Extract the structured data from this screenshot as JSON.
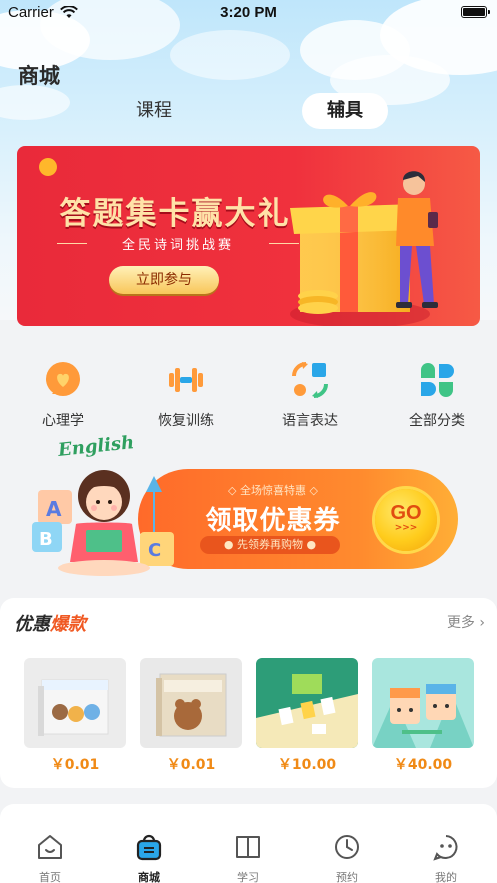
{
  "status_bar": {
    "carrier": "Carrier",
    "time": "3:20 PM"
  },
  "header": {
    "title": "商城"
  },
  "tabs": [
    {
      "label": "课程",
      "active": false
    },
    {
      "label": "辅具",
      "active": true
    }
  ],
  "banner": {
    "headline": "答题集卡赢大礼",
    "subtitle": "全民诗词挑战赛",
    "button": "立即参与"
  },
  "categories": [
    {
      "label": "心理学",
      "icon": "heart-bubble-icon"
    },
    {
      "label": "恢复训练",
      "icon": "dumbbell-icon"
    },
    {
      "label": "语言表达",
      "icon": "shapes-icon"
    },
    {
      "label": "全部分类",
      "icon": "four-petal-icon"
    }
  ],
  "coupon": {
    "decor_text": "English",
    "tag": "全场惊喜特惠",
    "headline": "领取优惠券",
    "pill": "先领券再购物",
    "go": "GO",
    "go_arrows": ">>>"
  },
  "hot": {
    "title_plain": "优惠",
    "title_emph": "爆款",
    "more": "更多",
    "products": [
      {
        "price": "￥0.01"
      },
      {
        "price": "￥0.01"
      },
      {
        "price": "￥10.00"
      },
      {
        "price": "￥40.00"
      }
    ]
  },
  "tabbar": {
    "items": [
      {
        "label": "首页",
        "icon": "home-icon",
        "active": false
      },
      {
        "label": "商城",
        "icon": "shopping-bag-icon",
        "active": true
      },
      {
        "label": "学习",
        "icon": "book-icon",
        "active": false
      },
      {
        "label": "预约",
        "icon": "clock-icon",
        "active": false
      },
      {
        "label": "我的",
        "icon": "face-icon",
        "active": false
      }
    ]
  },
  "colors": {
    "accent": "#f05a24",
    "price": "#f08a16",
    "banner_red": "#e92a3a",
    "coupon_orange": "#ff7a2c"
  }
}
